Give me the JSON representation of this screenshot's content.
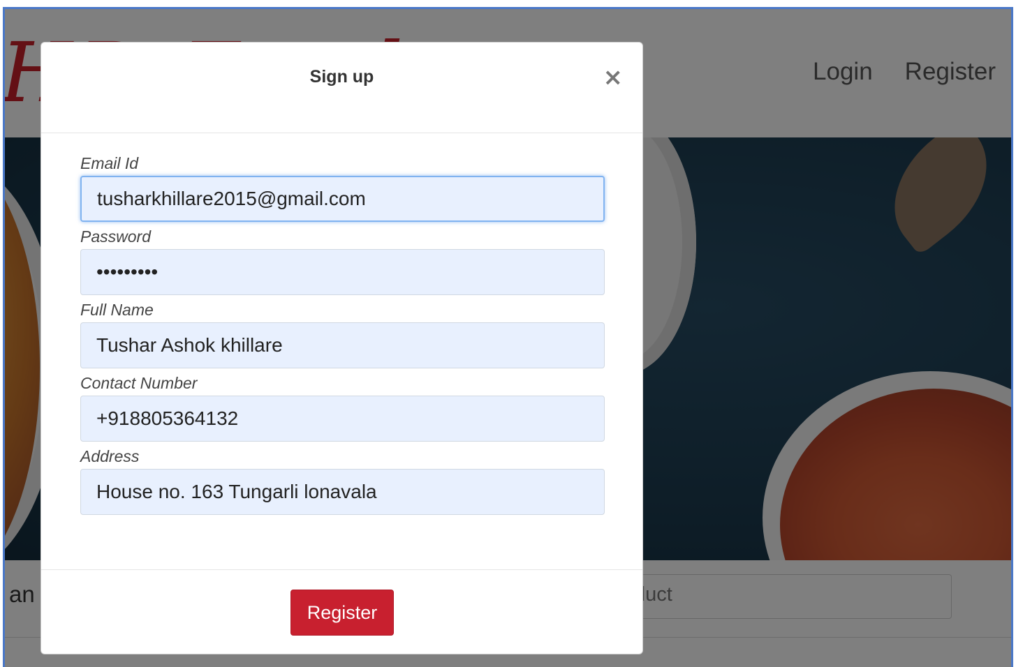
{
  "navbar": {
    "brand_text": "HD Food",
    "links": [
      "Login",
      "Register"
    ]
  },
  "search": {
    "label_fragment": "an",
    "placeholder_fragment": "duct"
  },
  "modal": {
    "title": "Sign up",
    "close_symbol": "×",
    "fields": [
      {
        "label": "Email Id",
        "value": "tusharkhillare2015@gmail.com",
        "type": "email",
        "focused": true
      },
      {
        "label": "Password",
        "value": "•••••••••",
        "type": "password",
        "focused": false
      },
      {
        "label": "Full Name",
        "value": "Tushar Ashok khillare",
        "type": "text",
        "focused": false
      },
      {
        "label": "Contact Number",
        "value": "+918805364132",
        "type": "text",
        "focused": false
      },
      {
        "label": "Address",
        "value": "House no. 163 Tungarli lonavala",
        "type": "text",
        "focused": false
      }
    ],
    "submit_label": "Register",
    "submit_color": "#c8202f"
  }
}
